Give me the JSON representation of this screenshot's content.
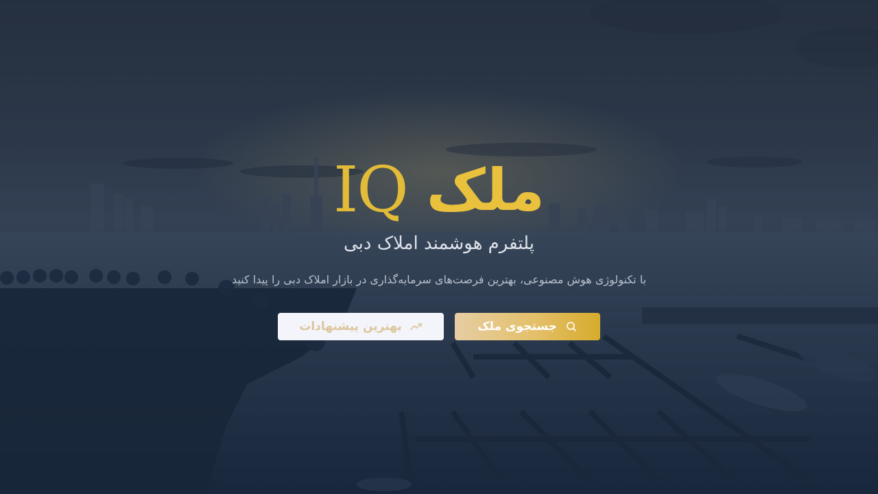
{
  "hero": {
    "brand_word": "ملک",
    "brand_mark": "IQ",
    "subtitle": "پلتفرم هوشمند املاک دبی",
    "tagline": "با تکنولوژی هوش مصنوعی، بهترین فرصت‌های سرمایه‌گذاری در بازار املاک دبی را پیدا کنید",
    "primary_button": {
      "label": "جستجوی ملک",
      "icon": "search-icon"
    },
    "secondary_button": {
      "label": "بهترین پیشنهادات",
      "icon": "trending-up-icon"
    }
  },
  "colors": {
    "brand_gold": "#e9c13d",
    "primary_gradient_start": "#e6cda3",
    "primary_gradient_end": "#d6ab2c",
    "secondary_bg": "#f3f5fa",
    "secondary_text": "#dcc59c",
    "overlay": "#142034"
  }
}
